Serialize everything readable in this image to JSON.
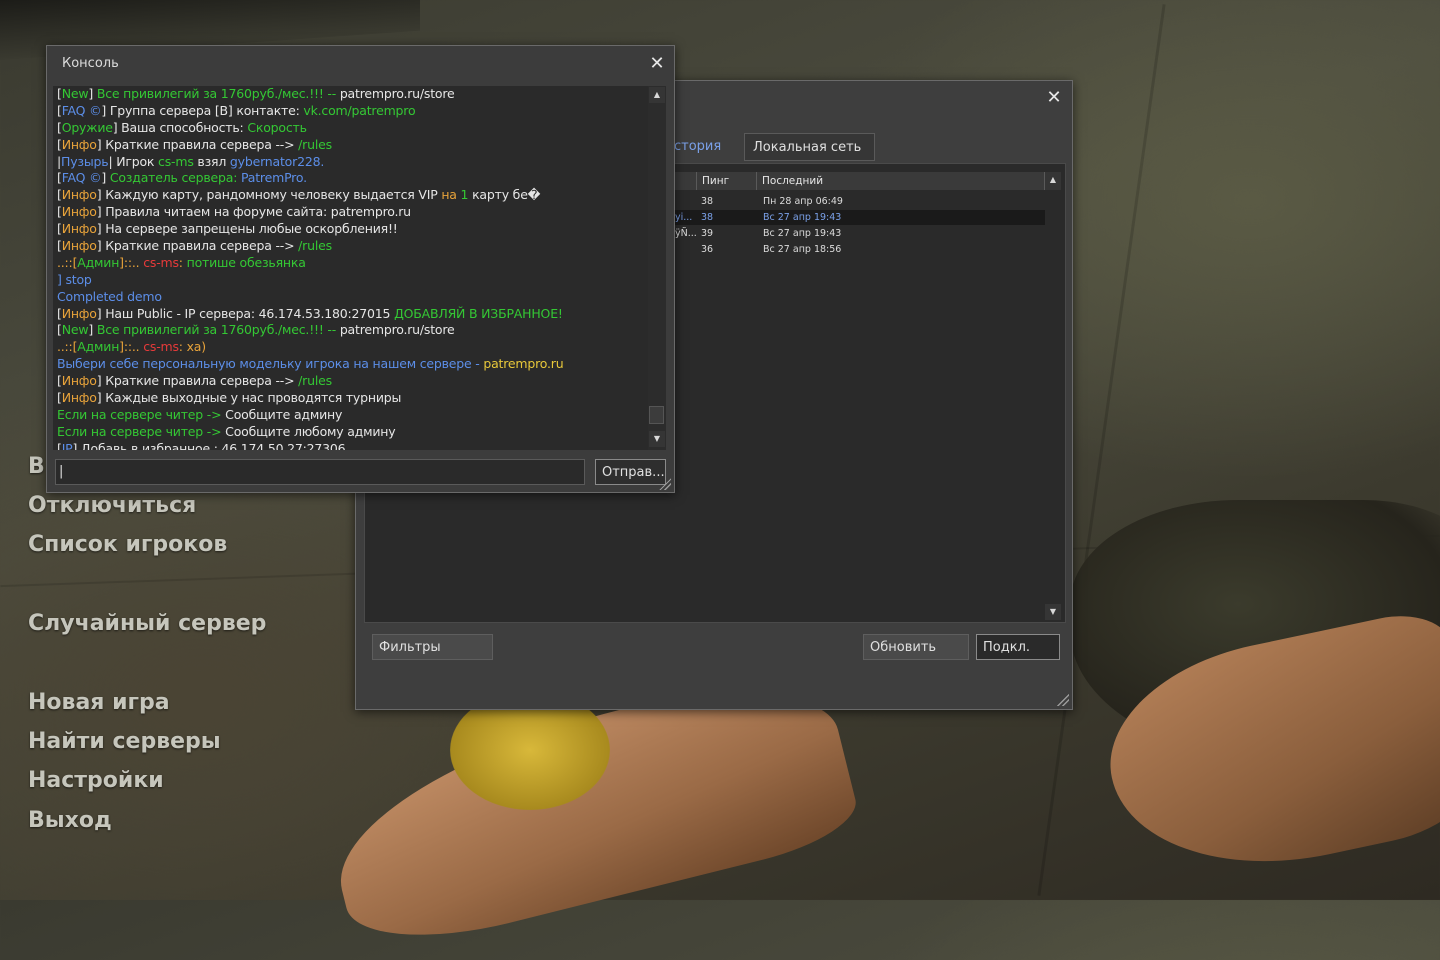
{
  "menu": {
    "items": [
      {
        "label": "Отключиться",
        "name": "menu-disconnect"
      },
      {
        "label": "Список игроков",
        "name": "menu-player-list"
      },
      {
        "label": "Случайный сервер",
        "name": "menu-random-server"
      },
      {
        "label": "Новая игра",
        "name": "menu-new-game"
      },
      {
        "label": "Найти серверы",
        "name": "menu-find-servers"
      },
      {
        "label": "Настройки",
        "name": "menu-settings"
      },
      {
        "label": "Выход",
        "name": "menu-exit"
      }
    ],
    "partial_item": "В"
  },
  "server_browser": {
    "tabs": {
      "history": "стория",
      "lan": "Локальная сеть"
    },
    "columns": {
      "ping": "Пинг",
      "last": "Последний"
    },
    "rows": [
      {
        "name": "",
        "ping": "38",
        "last": "Пн 28 апр 06:49"
      },
      {
        "name": "yi...",
        "ping": "38",
        "last": "Вс 27 апр 19:43"
      },
      {
        "name": "ÿÑ...",
        "ping": "39",
        "last": "Вс 27 апр 19:43"
      },
      {
        "name": "",
        "ping": "36",
        "last": "Вс 27 апр 18:56"
      }
    ],
    "buttons": {
      "filters": "Фильтры",
      "refresh": "Обновить",
      "connect": "Подкл."
    },
    "close_glyph": "✕"
  },
  "console": {
    "title": "Консоль",
    "close_glyph": "✕",
    "send_label": "Отправ...",
    "input_value": "|",
    "lines": [
      [
        [
          "cW",
          "["
        ],
        [
          "cG",
          "New"
        ],
        [
          "cW",
          "] "
        ],
        [
          "cG",
          "Все привилегий за 1760руб./мес.!!! -- "
        ],
        [
          "cW",
          "patrempro.ru/store"
        ]
      ],
      [
        [
          "cW",
          "["
        ],
        [
          "cB",
          "FAQ ©"
        ],
        [
          "cW",
          "] Группа сервера [В] контакте: "
        ],
        [
          "cG",
          "vk.com/patrempro"
        ]
      ],
      [
        [
          "cW",
          "["
        ],
        [
          "cG",
          "Оружие"
        ],
        [
          "cW",
          "] Ваша способность: "
        ],
        [
          "cG",
          "Скорость"
        ]
      ],
      [
        [
          "cW",
          "["
        ],
        [
          "cO",
          "Инфо"
        ],
        [
          "cW",
          "] Краткие правила сервера --> "
        ],
        [
          "cG",
          "/rules"
        ]
      ],
      [
        [
          "cW",
          "|"
        ],
        [
          "cB",
          "Пузырь"
        ],
        [
          "cW",
          "| Игрок "
        ],
        [
          "cG",
          "cs-ms"
        ],
        [
          "cW",
          " взял "
        ],
        [
          "cB",
          "gybernator228."
        ]
      ],
      [
        [
          "cW",
          "["
        ],
        [
          "cB",
          "FAQ ©"
        ],
        [
          "cW",
          "] "
        ],
        [
          "cG",
          "Создатель сервера: "
        ],
        [
          "cB",
          "PatremPro."
        ]
      ],
      [
        [
          "cW",
          "["
        ],
        [
          "cO",
          "Инфо"
        ],
        [
          "cW",
          "] Каждую карту, рандомному человеку выдается VIP "
        ],
        [
          "cO",
          "на "
        ],
        [
          "cG",
          "1"
        ],
        [
          "cW",
          " карту бе�"
        ]
      ],
      [
        [
          "cW",
          "["
        ],
        [
          "cO",
          "Инфо"
        ],
        [
          "cW",
          "] Правила читаем на форуме сайта: patrempro.ru"
        ]
      ],
      [
        [
          "cW",
          "["
        ],
        [
          "cO",
          "Инфо"
        ],
        [
          "cW",
          "] На сервере запрещены любые оскорбления!!"
        ]
      ],
      [
        [
          "cW",
          "["
        ],
        [
          "cO",
          "Инфо"
        ],
        [
          "cW",
          "] Краткие правила сервера --> "
        ],
        [
          "cG",
          "/rules"
        ]
      ],
      [
        [
          "cO",
          "..::["
        ],
        [
          "cG",
          "Админ"
        ],
        [
          "cO",
          "]::.. "
        ],
        [
          "cR",
          "cs-ms"
        ],
        [
          "cO",
          ": "
        ],
        [
          "cG",
          "потише обезьянка"
        ]
      ],
      [
        [
          "cB",
          "] stop"
        ]
      ],
      [
        [
          "cB",
          "Completed demo"
        ]
      ],
      [
        [
          "cW",
          "["
        ],
        [
          "cO",
          "Инфо"
        ],
        [
          "cW",
          "] Наш Public - IP сервера: 46.174.53.180:27015 "
        ],
        [
          "cG",
          "ДОБАВЛЯЙ В ИЗБРАННОЕ!"
        ]
      ],
      [
        [
          "cW",
          "["
        ],
        [
          "cG",
          "New"
        ],
        [
          "cW",
          "] "
        ],
        [
          "cG",
          "Все привилегий за 1760руб./мес.!!! -- "
        ],
        [
          "cW",
          "patrempro.ru/store"
        ]
      ],
      [
        [
          "cO",
          "..::["
        ],
        [
          "cG",
          "Админ"
        ],
        [
          "cO",
          "]::.. "
        ],
        [
          "cR",
          "cs-ms"
        ],
        [
          "cO",
          ": ха)"
        ]
      ],
      [
        [
          "cB",
          "Выбери себе персональную модельку игрока на нашем сервере - "
        ],
        [
          "cY",
          "patrempro.ru"
        ]
      ],
      [
        [
          "cW",
          "["
        ],
        [
          "cO",
          "Инфо"
        ],
        [
          "cW",
          "] Краткие правила сервера --> "
        ],
        [
          "cG",
          "/rules"
        ]
      ],
      [
        [
          "cW",
          "["
        ],
        [
          "cO",
          "Инфо"
        ],
        [
          "cW",
          "] Каждые выходные у нас проводятся турниры"
        ]
      ],
      [
        [
          "cG",
          "Если на сервере читер -> "
        ],
        [
          "cW",
          "Сообщите админу"
        ]
      ],
      [
        [
          "cG",
          "Если на сервере читер -> "
        ],
        [
          "cW",
          "Сообщите любому админу"
        ]
      ],
      [
        [
          "cW",
          "["
        ],
        [
          "cB",
          "IP"
        ],
        [
          "cW",
          "] Добавь в избранное : 46.174.50.27:27306"
        ]
      ]
    ]
  }
}
